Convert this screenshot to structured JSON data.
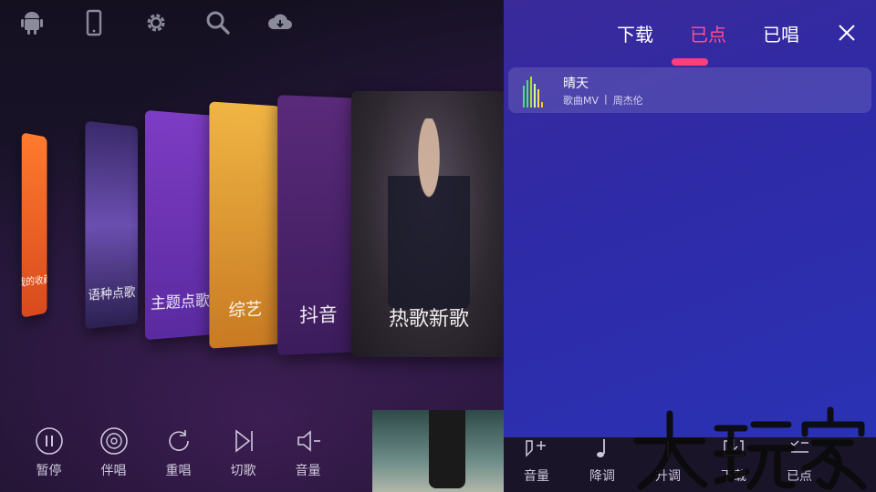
{
  "top_icons": [
    "android-icon",
    "phone-icon",
    "gear-icon",
    "search-icon",
    "cloud-download-icon"
  ],
  "cards": [
    {
      "label": "我的收藏"
    },
    {
      "label": "语种点歌"
    },
    {
      "label": "主题点歌"
    },
    {
      "label": "综艺"
    },
    {
      "label": "抖音"
    },
    {
      "label": "热歌新歌"
    }
  ],
  "controls": [
    {
      "label": "暂停",
      "icon": "pause-icon"
    },
    {
      "label": "伴唱",
      "icon": "disc-icon"
    },
    {
      "label": "重唱",
      "icon": "replay-icon"
    },
    {
      "label": "切歌",
      "icon": "skip-next-icon"
    },
    {
      "label": "音量",
      "icon": "volume-icon"
    }
  ],
  "panel": {
    "tabs": [
      {
        "label": "下载",
        "active": false
      },
      {
        "label": "已点",
        "active": true
      },
      {
        "label": "已唱",
        "active": false
      }
    ],
    "queue": [
      {
        "title": "晴天",
        "type": "歌曲MV",
        "separator": "|",
        "artist": "周杰伦",
        "playing": true
      }
    ],
    "accent_color": "#ff3d7f"
  },
  "bottom_controls": [
    {
      "label": "音量",
      "icon": "volume-up-icon"
    },
    {
      "label": "降调",
      "icon": "music-note-icon"
    },
    {
      "label": "升调",
      "icon": "music-note-up-icon"
    },
    {
      "label": "下载",
      "icon": "download-icon"
    },
    {
      "label": "已点",
      "icon": "list-check-icon"
    }
  ],
  "watermark": "大玩家"
}
